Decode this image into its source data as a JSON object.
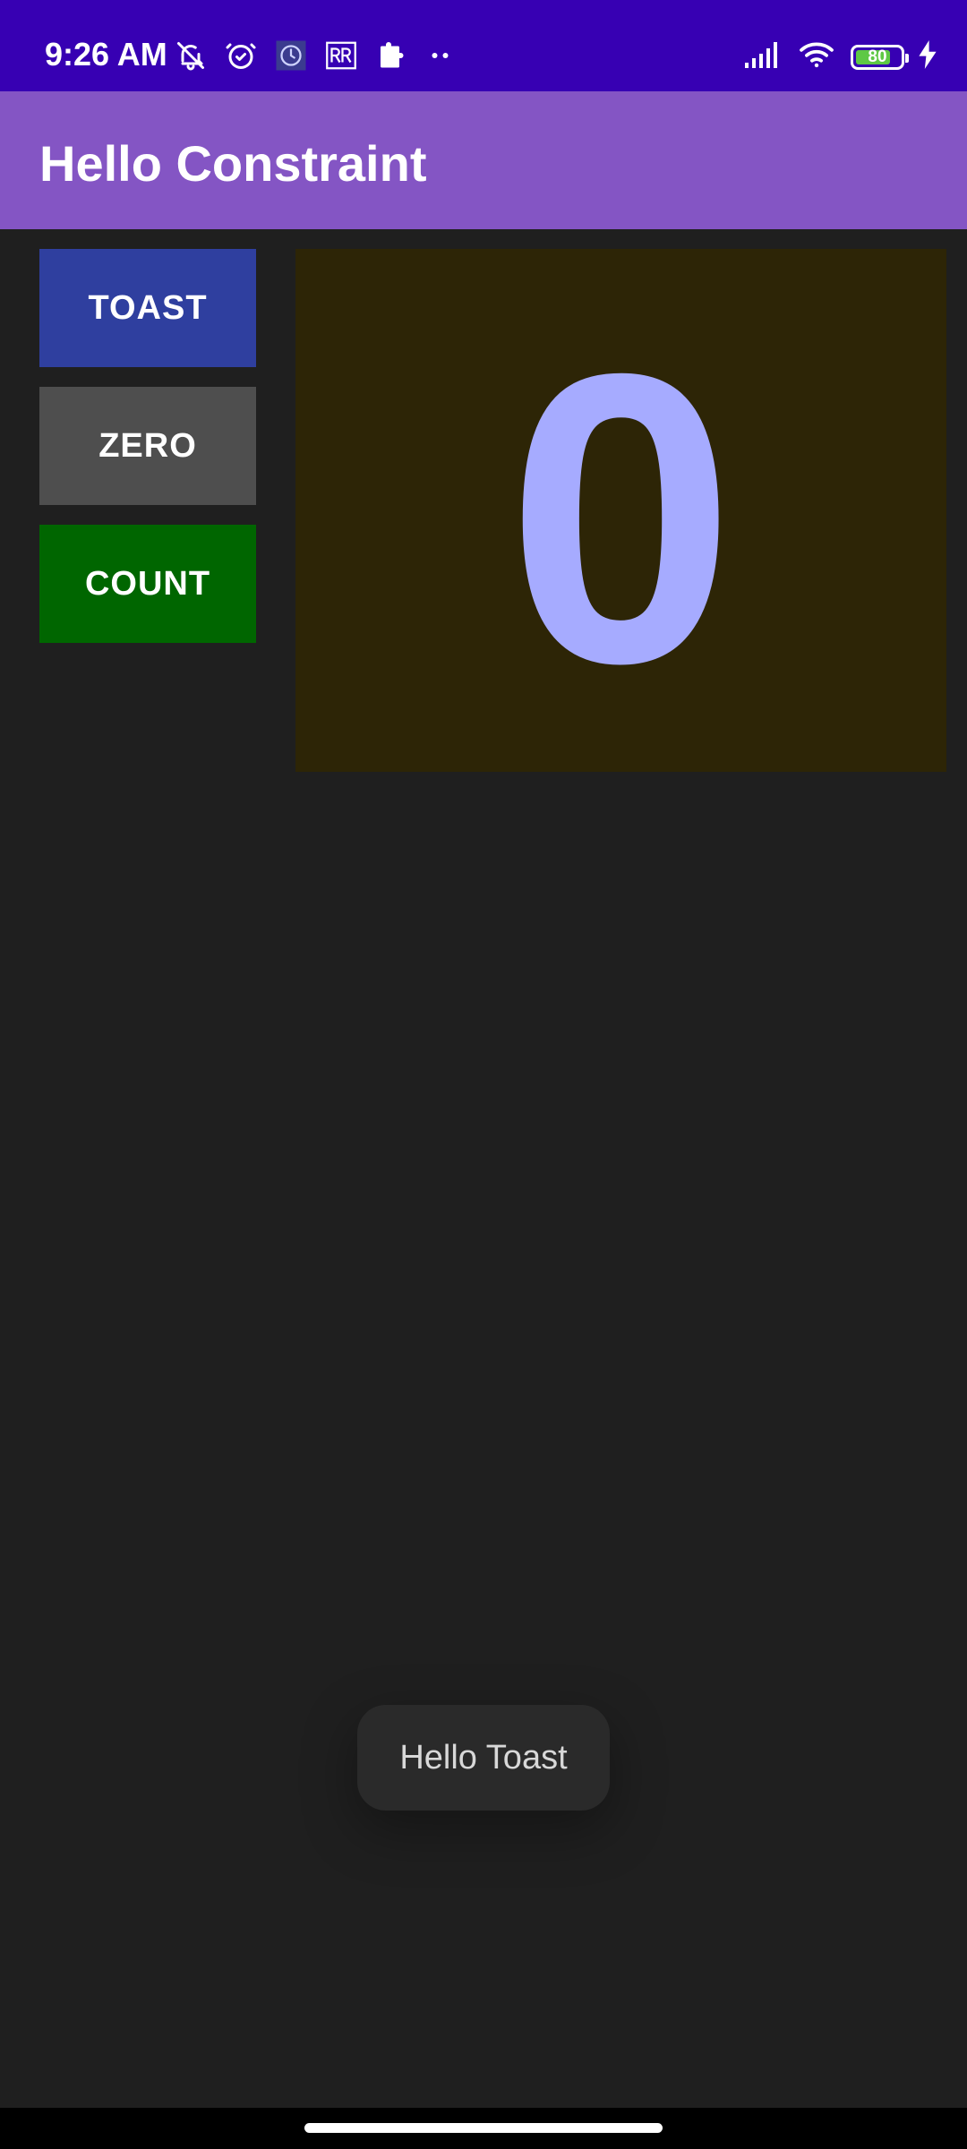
{
  "status_bar": {
    "time": "9:26 AM",
    "battery_level": "80",
    "battery_fraction": 0.8,
    "left_icons": [
      "bell-off-icon",
      "alarm-icon",
      "app-notification-icon",
      "rr-app-icon",
      "puzzle-icon",
      "more-dots-icon"
    ],
    "right_icons": [
      "signal-icon",
      "wifi-icon",
      "battery-icon",
      "charging-icon"
    ]
  },
  "app_bar": {
    "title": "Hello Constraint",
    "color": "#8455c4"
  },
  "buttons": {
    "toast": {
      "label": "TOAST",
      "color": "#2f3f9f"
    },
    "zero": {
      "label": "ZERO",
      "color": "#4e4e4e"
    },
    "count": {
      "label": "COUNT",
      "color": "#006600"
    }
  },
  "counter": {
    "value": "0",
    "text_color": "#a6abff",
    "background": "#2d2506"
  },
  "toast": {
    "message": "Hello Toast"
  },
  "colors": {
    "status_bar": "#3700b3",
    "background": "#1f1f1f"
  }
}
